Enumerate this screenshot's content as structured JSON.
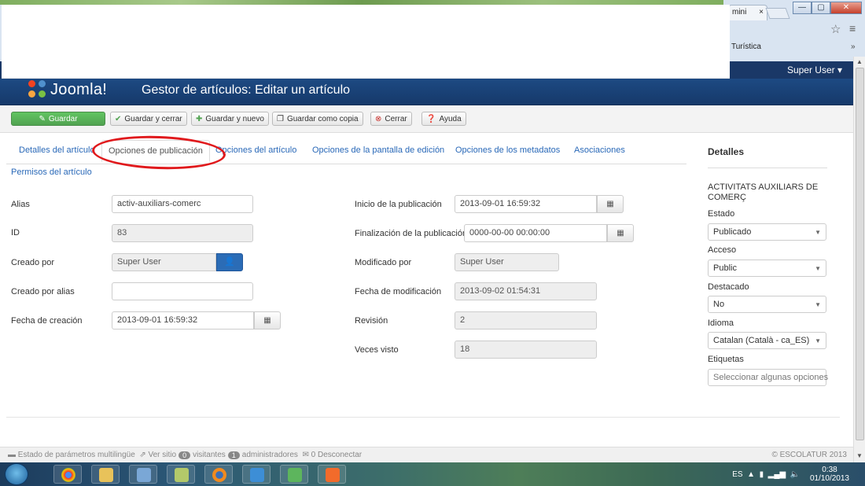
{
  "browser": {
    "tab_label": "mini",
    "tab_close": "×",
    "bookmark": "Turística",
    "overflow": "»",
    "min": "—",
    "max": "▢",
    "close": "✕"
  },
  "header": {
    "user_menu": "Super User ▾",
    "logo": "Joomla!",
    "title": "Gestor de artículos: Editar un artículo"
  },
  "toolbar": {
    "save": "Guardar",
    "save_close": "Guardar y cerrar",
    "save_new": "Guardar y nuevo",
    "save_copy": "Guardar como copia",
    "close": "Cerrar",
    "help": "Ayuda"
  },
  "tabs": {
    "details": "Detalles del artículo",
    "publishing": "Opciones de publicación",
    "article_options": "Opciones del artículo",
    "editor_options": "Opciones de la pantalla de edición",
    "metadata": "Opciones de los metadatos",
    "associations": "Asociaciones",
    "permissions": "Permisos del artículo"
  },
  "form": {
    "alias_label": "Alias",
    "alias_value": "activ-auxiliars-comerc",
    "id_label": "ID",
    "id_value": "83",
    "created_by_label": "Creado por",
    "created_by_value": "Super User",
    "created_alias_label": "Creado por alias",
    "created_alias_value": "",
    "created_date_label": "Fecha de creación",
    "created_date_value": "2013-09-01 16:59:32",
    "publish_up_label": "Inicio de la publicación",
    "publish_up_value": "2013-09-01 16:59:32",
    "publish_down_label": "Finalización de la publicación",
    "publish_down_value": "0000-00-00 00:00:00",
    "modified_by_label": "Modificado por",
    "modified_by_value": "Super User",
    "modified_date_label": "Fecha de modificación",
    "modified_date_value": "2013-09-02 01:54:31",
    "revision_label": "Revisión",
    "revision_value": "2",
    "hits_label": "Veces visto",
    "hits_value": "18"
  },
  "sidebar": {
    "title": "Detalles",
    "article_title": "ACTIVITATS AUXILIARS DE COMERÇ",
    "status_label": "Estado",
    "status_value": "Publicado",
    "access_label": "Acceso",
    "access_value": "Public",
    "featured_label": "Destacado",
    "featured_value": "No",
    "language_label": "Idioma",
    "language_value": "Catalan (Català - ca_ES)",
    "tags_label": "Etiquetas",
    "tags_placeholder": "Seleccionar algunas opciones"
  },
  "footer": {
    "multilang": "Estado de parámetros multilingüe",
    "view_site": "Ver sitio",
    "visitors_count": "0",
    "visitors": "visitantes",
    "admins_count": "1",
    "admins": "administradores",
    "logout": "0 Desconectar",
    "copyright": "© ESCOLATUR 2013"
  },
  "taskbar": {
    "lang": "ES",
    "time": "0:38",
    "date": "01/10/2013"
  },
  "colors": {
    "header_bg": "#1d4a83",
    "topbar_bg": "#1a3867",
    "save_green": "#51a351",
    "link_blue": "#2a69b8",
    "annotation_red": "#e0191c"
  }
}
